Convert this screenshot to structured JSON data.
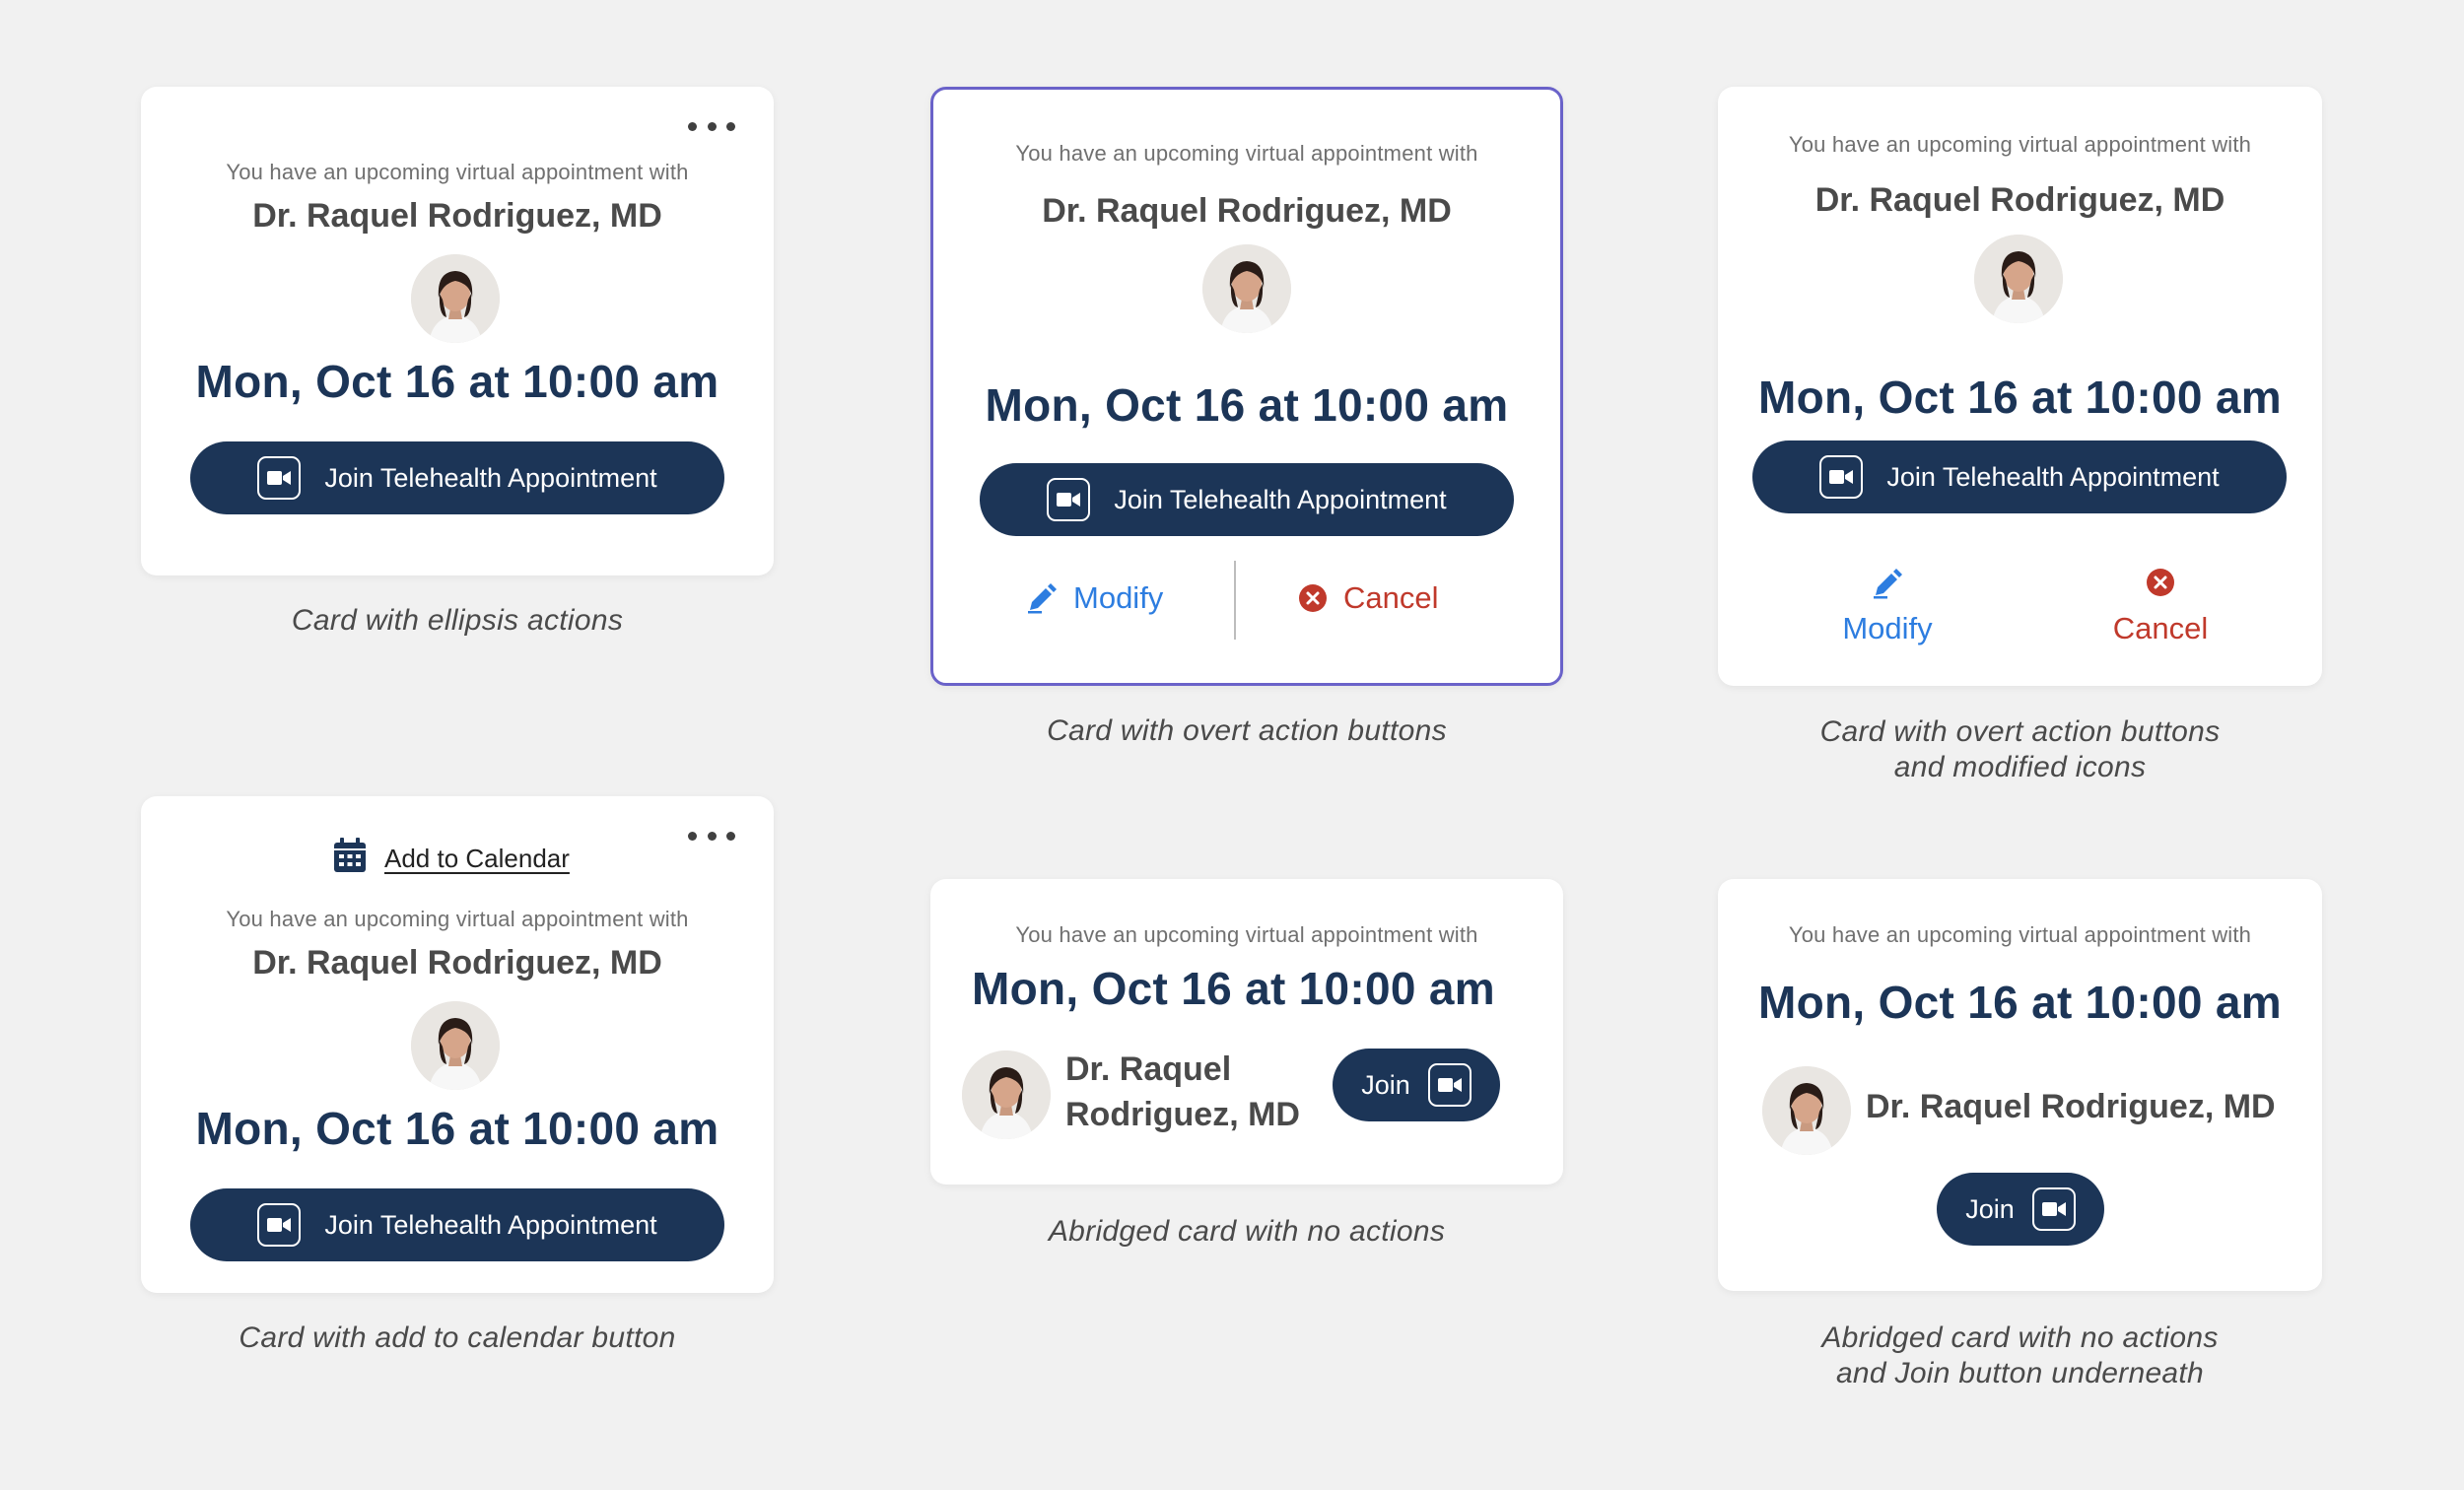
{
  "appointment": {
    "intro": "You have an upcoming virtual appointment with",
    "doctor": "Dr. Raquel Rodriguez, MD",
    "doctor_line1": "Dr. Raquel",
    "doctor_line2": "Rodriguez, MD",
    "datetime": "Mon, Oct 16 at 10:00 am"
  },
  "buttons": {
    "join_full": "Join Telehealth Appointment",
    "join_short": "Join",
    "modify": "Modify",
    "cancel": "Cancel",
    "add_calendar": "Add to Calendar"
  },
  "captions": {
    "c1": "Card with ellipsis actions",
    "c2": "Card with overt action buttons",
    "c3_l1": "Card with overt action buttons",
    "c3_l2": "and modified icons",
    "c4": "Card with add to calendar button",
    "c5": "Abridged card with no actions",
    "c6_l1": "Abridged card with no actions",
    "c6_l2": "and Join button underneath"
  },
  "colors": {
    "navy": "#1c3557",
    "modify_blue": "#2d7de0",
    "cancel_red": "#c0392b",
    "selected_border": "#6a62c9"
  },
  "icons": [
    "ellipsis-icon",
    "video-camera-icon",
    "pencil-icon",
    "cancel-circle-icon",
    "calendar-icon",
    "avatar"
  ]
}
